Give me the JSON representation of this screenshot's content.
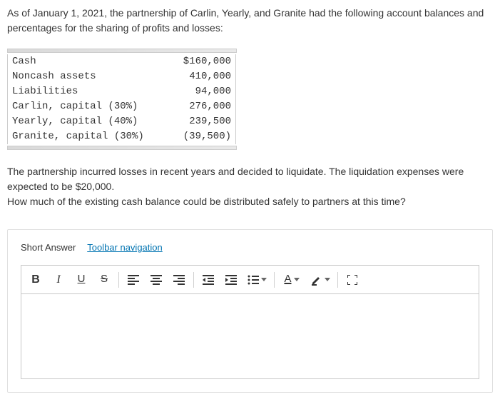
{
  "intro": "As of January 1, 2021, the partnership of Carlin, Yearly, and Granite had the following account balances and percentages for the sharing of profits and losses:",
  "ledger": [
    {
      "label": "Cash",
      "value": "$160,000"
    },
    {
      "label": "Noncash assets",
      "value": "410,000"
    },
    {
      "label": "Liabilities",
      "value": "94,000"
    },
    {
      "label": "Carlin, capital (30%)",
      "value": "276,000"
    },
    {
      "label": "Yearly, capital (40%)",
      "value": "239,500"
    },
    {
      "label": "Granite, capital (30%)",
      "value": "(39,500)"
    }
  ],
  "followup_line1": "The partnership incurred losses in recent years and decided to liquidate. The liquidation expenses were expected to be $20,000.",
  "followup_line2": "How much of the existing cash balance could be distributed safely to partners at this time?",
  "answer": {
    "short_label": "Short Answer",
    "toolbar_nav": "Toolbar navigation"
  },
  "tb": {
    "bold": "B",
    "italic": "I",
    "underline": "U",
    "strike": "S",
    "textcolor": "A"
  }
}
